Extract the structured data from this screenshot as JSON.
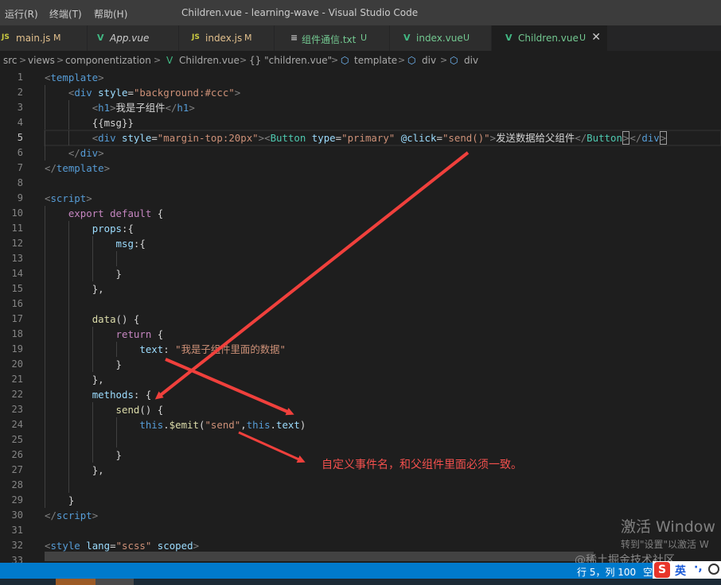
{
  "window": {
    "menus": [
      "运行(R)",
      "终端(T)",
      "帮助(H)"
    ],
    "title": "Children.vue - learning-wave - Visual Studio Code"
  },
  "tabs": [
    {
      "icon": "JS",
      "name": "main.js",
      "status": "M"
    },
    {
      "icon": "V",
      "name": "App.vue",
      "status": ""
    },
    {
      "icon": "JS",
      "name": "index.js",
      "status": "M"
    },
    {
      "icon": "≡",
      "name": "组件通信.txt",
      "status": "U"
    },
    {
      "icon": "V",
      "name": "index.vue",
      "status": "U"
    },
    {
      "icon": "V",
      "name": "Children.vue",
      "status": "U",
      "close": "✕"
    }
  ],
  "breadcrumb": {
    "items": [
      "src",
      "views",
      "componentization",
      "Children.vue",
      "{} \"children.vue\"",
      "template",
      "div",
      "div"
    ],
    "separator": ">"
  },
  "editor": {
    "line_numbers": [
      "1",
      "2",
      "3",
      "4",
      "5",
      "6",
      "7",
      "8",
      "9",
      "10",
      "11",
      "12",
      "13",
      "14",
      "15",
      "16",
      "17",
      "18",
      "19",
      "20",
      "21",
      "22",
      "23",
      "24",
      "25",
      "26",
      "27",
      "28",
      "29",
      "30",
      "31",
      "32",
      "33"
    ],
    "current_line": "5",
    "lines": {
      "l1": {
        "open": "<",
        "tag": "template",
        "close": ">"
      },
      "l2": {
        "open": "<",
        "tag": "div",
        "attr": "style",
        "eq": "=",
        "val": "\"background:#ccc\"",
        "close": ">"
      },
      "l3": {
        "open": "<",
        "tag": "h1",
        "close": ">",
        "text": "我是子组件",
        "end_open": "</",
        "end_tag": "h1",
        "end_close": ">"
      },
      "l4": {
        "text": "{{msg}}"
      },
      "l5": {
        "open": "<",
        "tag": "div",
        "attr": "style",
        "eq": "=",
        "val": "\"margin-top:20px\"",
        "close": ">",
        "comp_open": "<",
        "comp": "Button",
        "attr2": "type",
        "eq2": "=",
        "val2": "\"primary\"",
        "attr3": "@click",
        "eq3": "=",
        "val3": "\"send()\"",
        "close2": ">",
        "text": "发送数据给父组件",
        "end_comp_open": "</",
        "end_comp": "Button",
        "end_comp_close": ">",
        "end_open": "</",
        "end_tag": "div",
        "end_close": ">"
      },
      "l6": {
        "open": "</",
        "tag": "div",
        "close": ">"
      },
      "l7": {
        "open": "</",
        "tag": "template",
        "close": ">"
      },
      "l9": {
        "open": "<",
        "tag": "script",
        "close": ">"
      },
      "l10": {
        "kw1": "export",
        "kw2": "default",
        "brace": "{"
      },
      "l11": {
        "prop": "props",
        "rest": ":{"
      },
      "l12": {
        "prop": "msg",
        "rest": ":{"
      },
      "l14": {
        "text": "}"
      },
      "l15": {
        "text": "},"
      },
      "l17": {
        "fn": "data",
        "rest": "() {"
      },
      "l18": {
        "kw": "return",
        "rest": " {"
      },
      "l19": {
        "prop": "text",
        "colon": ": ",
        "val": "\"我是子组件里面的数据\""
      },
      "l20": {
        "text": "}"
      },
      "l21": {
        "text": "},"
      },
      "l22": {
        "prop": "methods",
        "rest": ": {"
      },
      "l23": {
        "fn": "send",
        "rest": "() {"
      },
      "l24": {
        "this1": "this",
        "dot1": ".",
        "fn": "$emit",
        "p1": "(",
        "val": "\"send\"",
        "comma": ",",
        "this2": "this",
        "dot2": ".",
        "prop": "text",
        "p2": ")"
      },
      "l26": {
        "text": "}"
      },
      "l27": {
        "text": "},"
      },
      "l29": {
        "text": "}"
      },
      "l30": {
        "open": "</",
        "tag": "script",
        "close": ">"
      },
      "l32": {
        "open": "<",
        "tag": "style",
        "attr": "lang",
        "eq": "=",
        "val": "\"scss\"",
        "attr2": "scoped",
        "close": ">"
      }
    }
  },
  "annotation": {
    "text": "自定义事件名，和父组件里面必须一致。",
    "color": "#f3504d"
  },
  "watermark": {
    "line1": "激活 Window",
    "line2": "转到\"设置\"以激活 W",
    "credit": "@稀土掘金技术社区"
  },
  "statusbar": {
    "position": "行 5，列 100",
    "spaces": "空"
  },
  "ime": {
    "logo": "S",
    "mode": "英",
    "punct": "·,"
  },
  "colors": {
    "statusbar": "#007acc",
    "titlebar": "#3c3c3c",
    "editor_bg": "#1e1e1e",
    "arrow": "#f0403c"
  }
}
